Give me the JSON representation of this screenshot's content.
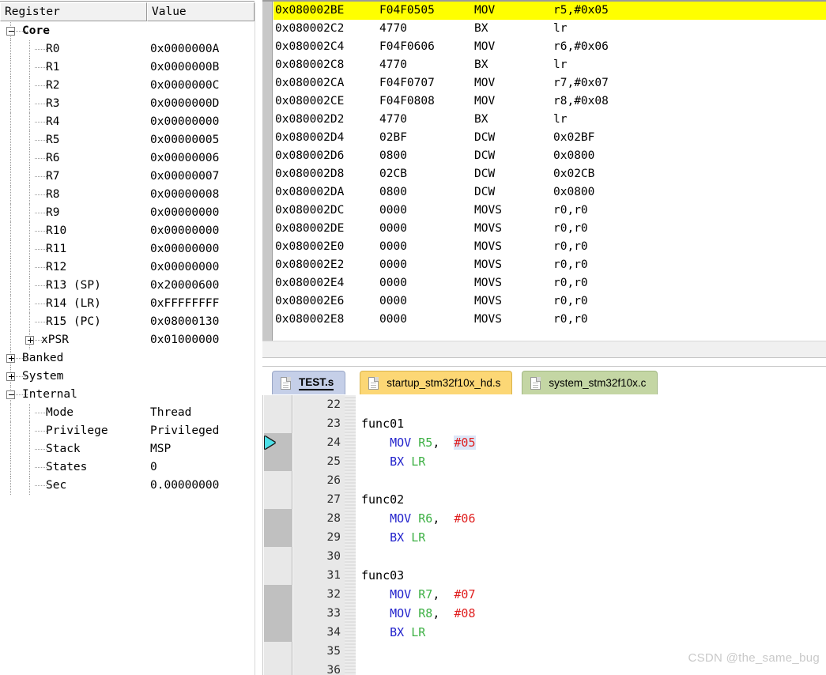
{
  "register_panel": {
    "columns": {
      "register": "Register",
      "value": "Value"
    },
    "rows": [
      {
        "name": "Core",
        "value": "",
        "depth": 0,
        "expander": "minus",
        "bold": true
      },
      {
        "name": "R0",
        "value": "0x0000000A",
        "depth": 2,
        "expander": "none",
        "bold": false
      },
      {
        "name": "R1",
        "value": "0x0000000B",
        "depth": 2,
        "expander": "none",
        "bold": false
      },
      {
        "name": "R2",
        "value": "0x0000000C",
        "depth": 2,
        "expander": "none",
        "bold": false
      },
      {
        "name": "R3",
        "value": "0x0000000D",
        "depth": 2,
        "expander": "none",
        "bold": false
      },
      {
        "name": "R4",
        "value": "0x00000000",
        "depth": 2,
        "expander": "none",
        "bold": false
      },
      {
        "name": "R5",
        "value": "0x00000005",
        "depth": 2,
        "expander": "none",
        "bold": false
      },
      {
        "name": "R6",
        "value": "0x00000006",
        "depth": 2,
        "expander": "none",
        "bold": false
      },
      {
        "name": "R7",
        "value": "0x00000007",
        "depth": 2,
        "expander": "none",
        "bold": false
      },
      {
        "name": "R8",
        "value": "0x00000008",
        "depth": 2,
        "expander": "none",
        "bold": false
      },
      {
        "name": "R9",
        "value": "0x00000000",
        "depth": 2,
        "expander": "none",
        "bold": false
      },
      {
        "name": "R10",
        "value": "0x00000000",
        "depth": 2,
        "expander": "none",
        "bold": false
      },
      {
        "name": "R11",
        "value": "0x00000000",
        "depth": 2,
        "expander": "none",
        "bold": false
      },
      {
        "name": "R12",
        "value": "0x00000000",
        "depth": 2,
        "expander": "none",
        "bold": false
      },
      {
        "name": "R13 (SP)",
        "value": "0x20000600",
        "depth": 2,
        "expander": "none",
        "bold": false
      },
      {
        "name": "R14 (LR)",
        "value": "0xFFFFFFFF",
        "depth": 2,
        "expander": "none",
        "bold": false
      },
      {
        "name": "R15 (PC)",
        "value": "0x08000130",
        "depth": 2,
        "expander": "none",
        "bold": false
      },
      {
        "name": "xPSR",
        "value": "0x01000000",
        "depth": 1,
        "expander": "plus",
        "bold": false
      },
      {
        "name": "Banked",
        "value": "",
        "depth": 0,
        "expander": "plus",
        "bold": false
      },
      {
        "name": "System",
        "value": "",
        "depth": 0,
        "expander": "plus",
        "bold": false
      },
      {
        "name": "Internal",
        "value": "",
        "depth": 0,
        "expander": "minus",
        "bold": false
      },
      {
        "name": "Mode",
        "value": "Thread",
        "depth": 2,
        "expander": "none",
        "bold": false
      },
      {
        "name": "Privilege",
        "value": "Privileged",
        "depth": 2,
        "expander": "none",
        "bold": false
      },
      {
        "name": "Stack",
        "value": "MSP",
        "depth": 2,
        "expander": "none",
        "bold": false
      },
      {
        "name": "States",
        "value": "0",
        "depth": 2,
        "expander": "none",
        "bold": false
      },
      {
        "name": "Sec",
        "value": "0.00000000",
        "depth": 2,
        "expander": "none",
        "bold": false
      }
    ]
  },
  "disassembly": {
    "highlight_color": "#ffff00",
    "rows": [
      {
        "address": "0x080002BE",
        "opcode": "F04F0505",
        "mnemonic": "MOV",
        "operands": "r5,#0x05",
        "highlighted": true
      },
      {
        "address": "0x080002C2",
        "opcode": "4770",
        "mnemonic": "BX",
        "operands": "lr",
        "highlighted": false
      },
      {
        "address": "0x080002C4",
        "opcode": "F04F0606",
        "mnemonic": "MOV",
        "operands": "r6,#0x06",
        "highlighted": false
      },
      {
        "address": "0x080002C8",
        "opcode": "4770",
        "mnemonic": "BX",
        "operands": "lr",
        "highlighted": false
      },
      {
        "address": "0x080002CA",
        "opcode": "F04F0707",
        "mnemonic": "MOV",
        "operands": "r7,#0x07",
        "highlighted": false
      },
      {
        "address": "0x080002CE",
        "opcode": "F04F0808",
        "mnemonic": "MOV",
        "operands": "r8,#0x08",
        "highlighted": false
      },
      {
        "address": "0x080002D2",
        "opcode": "4770",
        "mnemonic": "BX",
        "operands": "lr",
        "highlighted": false
      },
      {
        "address": "0x080002D4",
        "opcode": "02BF",
        "mnemonic": "DCW",
        "operands": "0x02BF",
        "highlighted": false
      },
      {
        "address": "0x080002D6",
        "opcode": "0800",
        "mnemonic": "DCW",
        "operands": "0x0800",
        "highlighted": false
      },
      {
        "address": "0x080002D8",
        "opcode": "02CB",
        "mnemonic": "DCW",
        "operands": "0x02CB",
        "highlighted": false
      },
      {
        "address": "0x080002DA",
        "opcode": "0800",
        "mnemonic": "DCW",
        "operands": "0x0800",
        "highlighted": false
      },
      {
        "address": "0x080002DC",
        "opcode": "0000",
        "mnemonic": "MOVS",
        "operands": "r0,r0",
        "highlighted": false
      },
      {
        "address": "0x080002DE",
        "opcode": "0000",
        "mnemonic": "MOVS",
        "operands": "r0,r0",
        "highlighted": false
      },
      {
        "address": "0x080002E0",
        "opcode": "0000",
        "mnemonic": "MOVS",
        "operands": "r0,r0",
        "highlighted": false
      },
      {
        "address": "0x080002E2",
        "opcode": "0000",
        "mnemonic": "MOVS",
        "operands": "r0,r0",
        "highlighted": false
      },
      {
        "address": "0x080002E4",
        "opcode": "0000",
        "mnemonic": "MOVS",
        "operands": "r0,r0",
        "highlighted": false
      },
      {
        "address": "0x080002E6",
        "opcode": "0000",
        "mnemonic": "MOVS",
        "operands": "r0,r0",
        "highlighted": false
      },
      {
        "address": "0x080002E8",
        "opcode": "0000",
        "mnemonic": "MOVS",
        "operands": "r0,r0",
        "highlighted": false
      }
    ]
  },
  "editor": {
    "tabs": [
      {
        "label": "TEST.s",
        "active": true,
        "color": "#c5cfe8"
      },
      {
        "label": "startup_stm32f10x_hd.s",
        "active": false,
        "color": "#fcd775"
      },
      {
        "label": "system_stm32f10x.c",
        "active": false,
        "color": "#c4d6a4"
      }
    ],
    "current_line": 24,
    "lines": [
      {
        "num": "22",
        "marked": false,
        "pc": false,
        "tokens": []
      },
      {
        "num": "23",
        "marked": false,
        "pc": false,
        "tokens": [
          {
            "t": "func01",
            "c": "plain"
          }
        ]
      },
      {
        "num": "24",
        "marked": true,
        "pc": true,
        "tokens": [
          {
            "t": "    ",
            "c": "plain"
          },
          {
            "t": "MOV",
            "c": "mnem"
          },
          {
            "t": " ",
            "c": "plain"
          },
          {
            "t": "R5",
            "c": "reg"
          },
          {
            "t": ",  ",
            "c": "plain"
          },
          {
            "t": "#05",
            "c": "imm-sel"
          }
        ]
      },
      {
        "num": "25",
        "marked": true,
        "pc": false,
        "tokens": [
          {
            "t": "    ",
            "c": "plain"
          },
          {
            "t": "BX",
            "c": "mnem"
          },
          {
            "t": " ",
            "c": "plain"
          },
          {
            "t": "LR",
            "c": "reg"
          }
        ]
      },
      {
        "num": "26",
        "marked": false,
        "pc": false,
        "tokens": []
      },
      {
        "num": "27",
        "marked": false,
        "pc": false,
        "tokens": [
          {
            "t": "func02",
            "c": "plain"
          }
        ]
      },
      {
        "num": "28",
        "marked": true,
        "pc": false,
        "tokens": [
          {
            "t": "    ",
            "c": "plain"
          },
          {
            "t": "MOV",
            "c": "mnem"
          },
          {
            "t": " ",
            "c": "plain"
          },
          {
            "t": "R6",
            "c": "reg"
          },
          {
            "t": ",  ",
            "c": "plain"
          },
          {
            "t": "#06",
            "c": "imm"
          }
        ]
      },
      {
        "num": "29",
        "marked": true,
        "pc": false,
        "tokens": [
          {
            "t": "    ",
            "c": "plain"
          },
          {
            "t": "BX",
            "c": "mnem"
          },
          {
            "t": " ",
            "c": "plain"
          },
          {
            "t": "LR",
            "c": "reg"
          }
        ]
      },
      {
        "num": "30",
        "marked": false,
        "pc": false,
        "tokens": []
      },
      {
        "num": "31",
        "marked": false,
        "pc": false,
        "tokens": [
          {
            "t": "func03",
            "c": "plain"
          }
        ]
      },
      {
        "num": "32",
        "marked": true,
        "pc": false,
        "tokens": [
          {
            "t": "    ",
            "c": "plain"
          },
          {
            "t": "MOV",
            "c": "mnem"
          },
          {
            "t": " ",
            "c": "plain"
          },
          {
            "t": "R7",
            "c": "reg"
          },
          {
            "t": ",  ",
            "c": "plain"
          },
          {
            "t": "#07",
            "c": "imm"
          }
        ]
      },
      {
        "num": "33",
        "marked": true,
        "pc": false,
        "tokens": [
          {
            "t": "    ",
            "c": "plain"
          },
          {
            "t": "MOV",
            "c": "mnem"
          },
          {
            "t": " ",
            "c": "plain"
          },
          {
            "t": "R8",
            "c": "reg"
          },
          {
            "t": ",  ",
            "c": "plain"
          },
          {
            "t": "#08",
            "c": "imm"
          }
        ]
      },
      {
        "num": "34",
        "marked": true,
        "pc": false,
        "tokens": [
          {
            "t": "    ",
            "c": "plain"
          },
          {
            "t": "BX",
            "c": "mnem"
          },
          {
            "t": " ",
            "c": "plain"
          },
          {
            "t": "LR",
            "c": "reg"
          }
        ]
      },
      {
        "num": "35",
        "marked": false,
        "pc": false,
        "tokens": []
      },
      {
        "num": "36",
        "marked": false,
        "pc": false,
        "tokens": []
      }
    ],
    "colors": {
      "mnemonic": "#2222cc",
      "register": "#3cb043",
      "immediate": "#e02020",
      "selection": "#dce6f7",
      "gutter_mark": "#c0c0c0",
      "pc_arrow": "#4de0e8"
    }
  },
  "watermark": {
    "text": "CSDN @the_same_bug"
  }
}
